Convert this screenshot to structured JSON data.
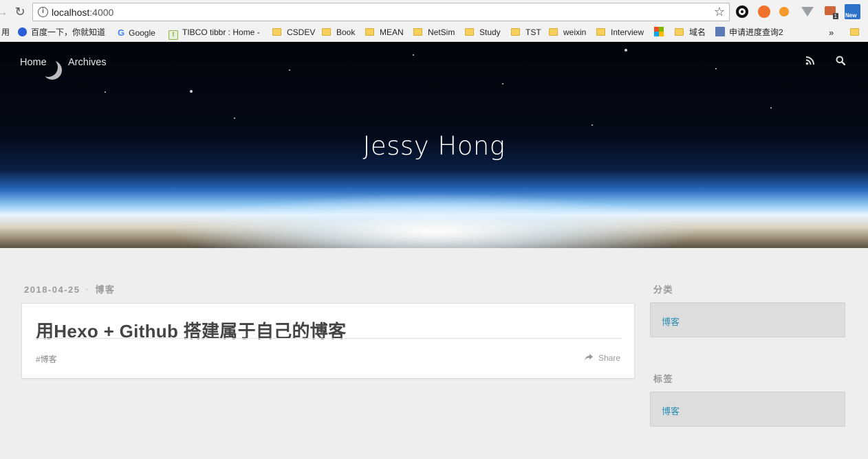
{
  "browser": {
    "url_host": "localhost",
    "url_port": ":4000",
    "bookmarks": [
      {
        "label": "用",
        "kind": "text"
      },
      {
        "label": "百度一下，你就知道",
        "kind": "baidu"
      },
      {
        "label": "Google",
        "kind": "google"
      },
      {
        "label": "TIBCO tibbr : Home -",
        "kind": "tibbr"
      },
      {
        "label": "CSDEV",
        "kind": "folder"
      },
      {
        "label": "Book",
        "kind": "folder"
      },
      {
        "label": "MEAN",
        "kind": "folder"
      },
      {
        "label": "NetSim",
        "kind": "folder"
      },
      {
        "label": "Study",
        "kind": "folder"
      },
      {
        "label": "TST",
        "kind": "folder"
      },
      {
        "label": "weixin",
        "kind": "folder"
      },
      {
        "label": "Interview",
        "kind": "folder"
      },
      {
        "label": "域名",
        "kind": "folder"
      },
      {
        "label": "申请进度查询2",
        "kind": "page"
      }
    ],
    "overflow": "»",
    "ext_badge": "1",
    "ext_new": "New"
  },
  "header": {
    "nav": [
      "Home",
      "Archives"
    ],
    "site_title": "Jessy Hong",
    "icons": [
      "rss-icon",
      "search-icon"
    ]
  },
  "post": {
    "date": "2018-04-25",
    "category": "博客",
    "title": "用Hexo + Github 搭建属于自己的博客",
    "tag": "#博客",
    "share_label": "Share"
  },
  "sidebar": {
    "categories_heading": "分类",
    "categories": [
      "博客"
    ],
    "tags_heading": "标签",
    "tags": [
      "博客"
    ]
  },
  "colors": {
    "page_bg": "#eeeeee",
    "link": "#2e8fb4",
    "meta": "#9a9a9a"
  }
}
